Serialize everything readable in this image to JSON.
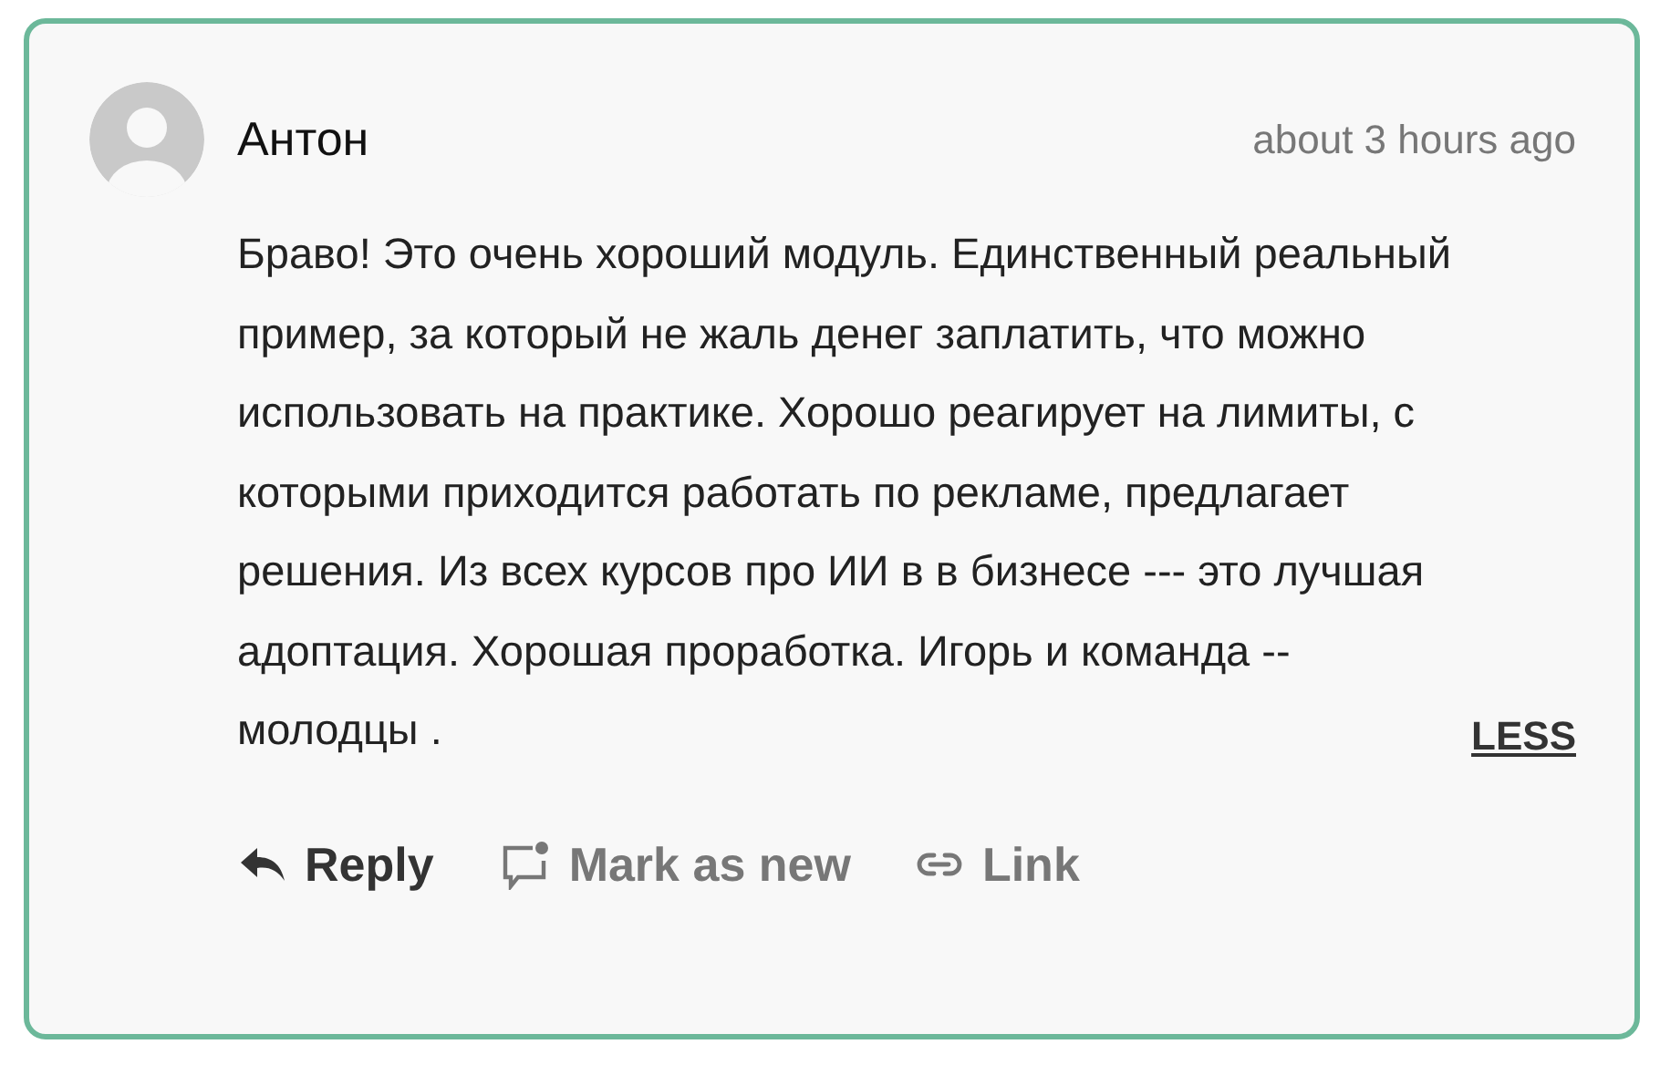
{
  "comment": {
    "author": "Антон",
    "time": "about 3 hours ago",
    "body": "Браво! Это очень хороший модуль. Единственный реальный пример, за который не жаль денег заплатить, что можно использовать на практике. Хорошо реагирует на лимиты, с которыми приходится работать по рекламе, предлагает решения. Из всех курсов про ИИ в в бизнесе --- это лучшая адоптация. Хорошая проработка. Игорь и команда -- молодцы .",
    "toggle": "LESS",
    "actions": [
      {
        "kind": "reply",
        "label": "Reply"
      },
      {
        "kind": "mark",
        "label": "Mark as new"
      },
      {
        "kind": "link",
        "label": "Link"
      }
    ]
  }
}
